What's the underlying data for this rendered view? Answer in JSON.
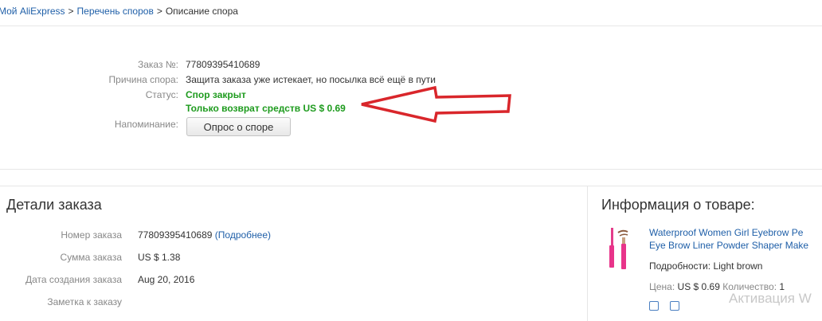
{
  "breadcrumb": {
    "home": "Мой AliExpress",
    "separator": ">",
    "disputes": "Перечень споров",
    "current": "Описание спора"
  },
  "dispute": {
    "order_label": "Заказ №:",
    "order_value": "77809395410689",
    "reason_label": "Причина спора:",
    "reason_value": "Защита заказа уже истекает, но посылка всё ещё в пути",
    "status_label": "Статус:",
    "status_value": "Спор закрыт",
    "status_detail": "Только возврат средств US $ 0.69",
    "reminder_label": "Напоминание:",
    "survey_button": "Опрос о споре"
  },
  "order_details": {
    "title": "Детали заказа",
    "rows": [
      {
        "label": "Номер заказа",
        "value": "77809395410689",
        "link": "(Подробнее)"
      },
      {
        "label": "Сумма заказа",
        "value": "US $ 1.38"
      },
      {
        "label": "Дата создания заказа",
        "value": "Aug 20, 2016"
      },
      {
        "label": "Заметка к заказу",
        "value": ""
      }
    ]
  },
  "product_info": {
    "title": "Информация о товаре:",
    "name_line1": "Waterproof Women Girl Eyebrow Pe",
    "name_line2": "Eye Brow Liner Powder Shaper Make",
    "details_label": "Подробности:",
    "details_value": "Light brown",
    "price_label": "Цена:",
    "price_value": "US $ 0.69",
    "qty_label": "Количество:",
    "qty_value": "1"
  },
  "watermark": "Активация W",
  "colors": {
    "link": "#1f5fa8",
    "status_green": "#1e9b1e",
    "arrow_red": "#d9262b",
    "label_gray": "#888888"
  }
}
